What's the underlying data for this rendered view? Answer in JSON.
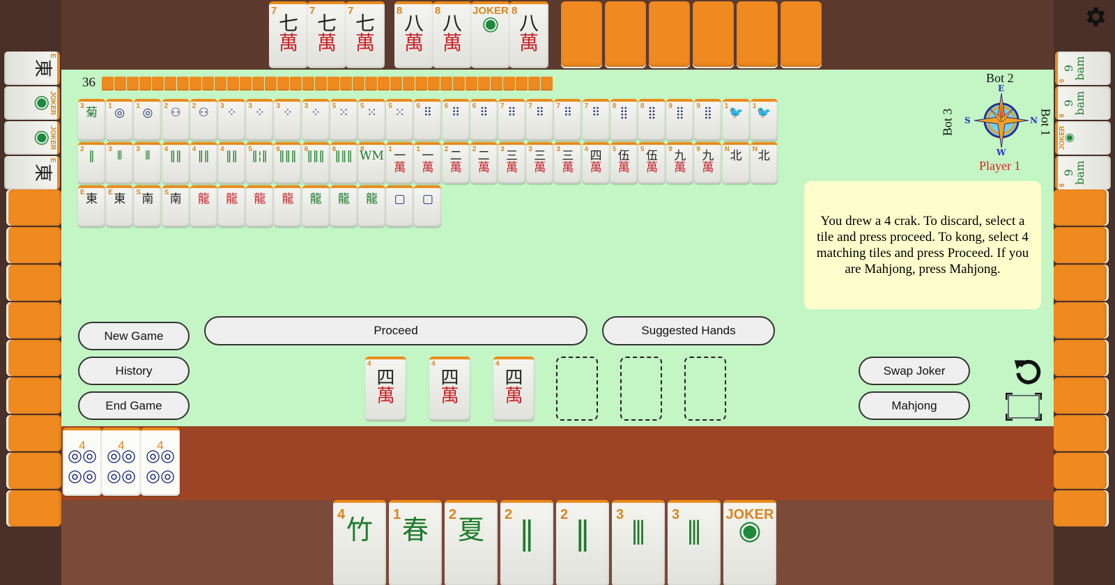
{
  "wall": {
    "remaining": 36
  },
  "players": {
    "top": "Bot 2",
    "left": "Bot 3",
    "right": "Bot 1",
    "bottom": "Player 1"
  },
  "compass": {
    "north": "N",
    "south": "S",
    "east": "E",
    "west": "W"
  },
  "bot2_exposed": [
    {
      "rank": "7",
      "glyph": "七",
      "suit": "crak"
    },
    {
      "rank": "7",
      "glyph": "七",
      "suit": "crak"
    },
    {
      "rank": "7",
      "glyph": "七",
      "suit": "crak"
    },
    {
      "rank": "8",
      "glyph": "八",
      "suit": "crak"
    },
    {
      "rank": "8",
      "glyph": "八",
      "suit": "crak"
    },
    {
      "rank": "JOKER",
      "glyph": "◉",
      "suit": "joker"
    },
    {
      "rank": "8",
      "glyph": "八",
      "suit": "crak"
    }
  ],
  "bot2_hidden_count": 6,
  "bot3_exposed": [
    {
      "rank": "E",
      "glyph": "東",
      "suit": "wind"
    },
    {
      "rank": "JOKER",
      "glyph": "◉",
      "suit": "joker"
    },
    {
      "rank": "JOKER",
      "glyph": "◉",
      "suit": "joker"
    },
    {
      "rank": "E",
      "glyph": "東",
      "suit": "wind"
    }
  ],
  "bot3_hidden_count": 9,
  "bot1_exposed": [
    {
      "rank": "9",
      "glyph": "9 bam",
      "suit": "bam"
    },
    {
      "rank": "9",
      "glyph": "9 bam",
      "suit": "bam"
    },
    {
      "rank": "JOKER",
      "glyph": "◉",
      "suit": "joker"
    },
    {
      "rank": "9",
      "glyph": "9 bam",
      "suit": "bam"
    }
  ],
  "bot1_hidden_count": 9,
  "discards": {
    "row1": [
      {
        "rank": "3",
        "glyph": "菊",
        "suit": "flower"
      },
      {
        "rank": "1",
        "glyph": "◎",
        "suit": "dot"
      },
      {
        "rank": "1",
        "glyph": "◎",
        "suit": "dot"
      },
      {
        "rank": "2",
        "glyph": "⚇",
        "suit": "dot"
      },
      {
        "rank": "2",
        "glyph": "⚇",
        "suit": "dot"
      },
      {
        "rank": "3",
        "glyph": "⁘",
        "suit": "dot"
      },
      {
        "rank": "3",
        "glyph": "⁘",
        "suit": "dot"
      },
      {
        "rank": "3",
        "glyph": "⁘",
        "suit": "dot"
      },
      {
        "rank": "3",
        "glyph": "⁘",
        "suit": "dot"
      },
      {
        "rank": "5",
        "glyph": "⁙",
        "suit": "dot"
      },
      {
        "rank": "5",
        "glyph": "⁙",
        "suit": "dot"
      },
      {
        "rank": "5",
        "glyph": "⁙",
        "suit": "dot"
      },
      {
        "rank": "6",
        "glyph": "⠿",
        "suit": "dot"
      },
      {
        "rank": "6",
        "glyph": "⠿",
        "suit": "dot"
      },
      {
        "rank": "6",
        "glyph": "⠿",
        "suit": "dot"
      },
      {
        "rank": "7",
        "glyph": "⠿",
        "suit": "dot"
      },
      {
        "rank": "7",
        "glyph": "⠿",
        "suit": "dot"
      },
      {
        "rank": "7",
        "glyph": "⠿",
        "suit": "dot"
      },
      {
        "rank": "7",
        "glyph": "⠿",
        "suit": "dot"
      },
      {
        "rank": "8",
        "glyph": "⣿",
        "suit": "dot"
      },
      {
        "rank": "8",
        "glyph": "⣿",
        "suit": "dot"
      },
      {
        "rank": "9",
        "glyph": "⣿",
        "suit": "dot"
      },
      {
        "rank": "9",
        "glyph": "⣿",
        "suit": "dot"
      },
      {
        "rank": "1",
        "glyph": "🐦",
        "suit": "bam"
      },
      {
        "rank": "1",
        "glyph": "🐦",
        "suit": "bam"
      }
    ],
    "row2": [
      {
        "rank": "2",
        "glyph": "‖",
        "suit": "bam"
      },
      {
        "rank": "3",
        "glyph": "⫴",
        "suit": "bam"
      },
      {
        "rank": "3",
        "glyph": "⫴",
        "suit": "bam"
      },
      {
        "rank": "4",
        "glyph": "‖‖",
        "suit": "bam"
      },
      {
        "rank": "4",
        "glyph": "‖‖",
        "suit": "bam"
      },
      {
        "rank": "4",
        "glyph": "‖‖",
        "suit": "bam"
      },
      {
        "rank": "5",
        "glyph": "‖¦‖",
        "suit": "bam"
      },
      {
        "rank": "6",
        "glyph": "‖‖‖",
        "suit": "bam"
      },
      {
        "rank": "6",
        "glyph": "‖‖‖",
        "suit": "bam"
      },
      {
        "rank": "6",
        "glyph": "‖‖‖",
        "suit": "bam"
      },
      {
        "rank": "8",
        "glyph": "WM",
        "suit": "bam"
      },
      {
        "rank": "1",
        "glyph": "一",
        "suit": "crak"
      },
      {
        "rank": "1",
        "glyph": "一",
        "suit": "crak"
      },
      {
        "rank": "2",
        "glyph": "二",
        "suit": "crak"
      },
      {
        "rank": "2",
        "glyph": "二",
        "suit": "crak"
      },
      {
        "rank": "3",
        "glyph": "三",
        "suit": "crak"
      },
      {
        "rank": "3",
        "glyph": "三",
        "suit": "crak"
      },
      {
        "rank": "3",
        "glyph": "三",
        "suit": "crak"
      },
      {
        "rank": "4",
        "glyph": "四",
        "suit": "crak"
      },
      {
        "rank": "5",
        "glyph": "伍",
        "suit": "crak"
      },
      {
        "rank": "5",
        "glyph": "伍",
        "suit": "crak"
      },
      {
        "rank": "9",
        "glyph": "九",
        "suit": "crak"
      },
      {
        "rank": "9",
        "glyph": "九",
        "suit": "crak"
      },
      {
        "rank": "N",
        "glyph": "北",
        "suit": "wind"
      },
      {
        "rank": "N",
        "glyph": "北",
        "suit": "wind"
      }
    ],
    "row3": [
      {
        "rank": "E",
        "glyph": "東",
        "suit": "wind"
      },
      {
        "rank": "E",
        "glyph": "東",
        "suit": "wind"
      },
      {
        "rank": "S",
        "glyph": "南",
        "suit": "wind"
      },
      {
        "rank": "S",
        "glyph": "南",
        "suit": "wind"
      },
      {
        "rank": "",
        "glyph": "龍",
        "suit": "red-dragon"
      },
      {
        "rank": "",
        "glyph": "龍",
        "suit": "red-dragon"
      },
      {
        "rank": "",
        "glyph": "龍",
        "suit": "red-dragon"
      },
      {
        "rank": "",
        "glyph": "龍",
        "suit": "red-dragon"
      },
      {
        "rank": "",
        "glyph": "龍",
        "suit": "green-dragon"
      },
      {
        "rank": "",
        "glyph": "龍",
        "suit": "green-dragon"
      },
      {
        "rank": "",
        "glyph": "龍",
        "suit": "green-dragon"
      },
      {
        "rank": "",
        "glyph": "▢",
        "suit": "white-dragon"
      },
      {
        "rank": "",
        "glyph": "▢",
        "suit": "white-dragon"
      }
    ]
  },
  "buttons": {
    "new_game": "New Game",
    "history": "History",
    "end_game": "End Game",
    "proceed": "Proceed",
    "suggested_hands": "Suggested Hands",
    "swap_joker": "Swap Joker",
    "mahjong": "Mahjong"
  },
  "message": "You drew a 4 crak. To discard, select a tile and press proceed. To kong, select 4 matching tiles and press Proceed. If you are Mahjong, press Mahjong.",
  "staging": {
    "tiles": [
      {
        "rank": "4",
        "glyph": "四",
        "suit": "crak"
      },
      {
        "rank": "4",
        "glyph": "四",
        "suit": "crak"
      },
      {
        "rank": "4",
        "glyph": "四",
        "suit": "crak"
      }
    ],
    "empty_slots": 3
  },
  "player_exposed": [
    {
      "rank": "4",
      "suit": "dot"
    },
    {
      "rank": "4",
      "suit": "dot"
    },
    {
      "rank": "4",
      "suit": "dot"
    }
  ],
  "player_hand": [
    {
      "rank": "4",
      "glyph": "竹",
      "suit": "flower"
    },
    {
      "rank": "1",
      "glyph": "春",
      "suit": "flower"
    },
    {
      "rank": "2",
      "glyph": "夏",
      "suit": "flower"
    },
    {
      "rank": "2",
      "glyph": "‖",
      "suit": "bam"
    },
    {
      "rank": "2",
      "glyph": "‖",
      "suit": "bam"
    },
    {
      "rank": "3",
      "glyph": "⫴",
      "suit": "bam"
    },
    {
      "rank": "3",
      "glyph": "⫴",
      "suit": "bam"
    },
    {
      "rank": "JOKER",
      "glyph": "◉",
      "suit": "joker"
    }
  ],
  "icons": {
    "settings": "gear-icon",
    "undo": "undo-icon",
    "fullscreen": "fullscreen-icon"
  }
}
